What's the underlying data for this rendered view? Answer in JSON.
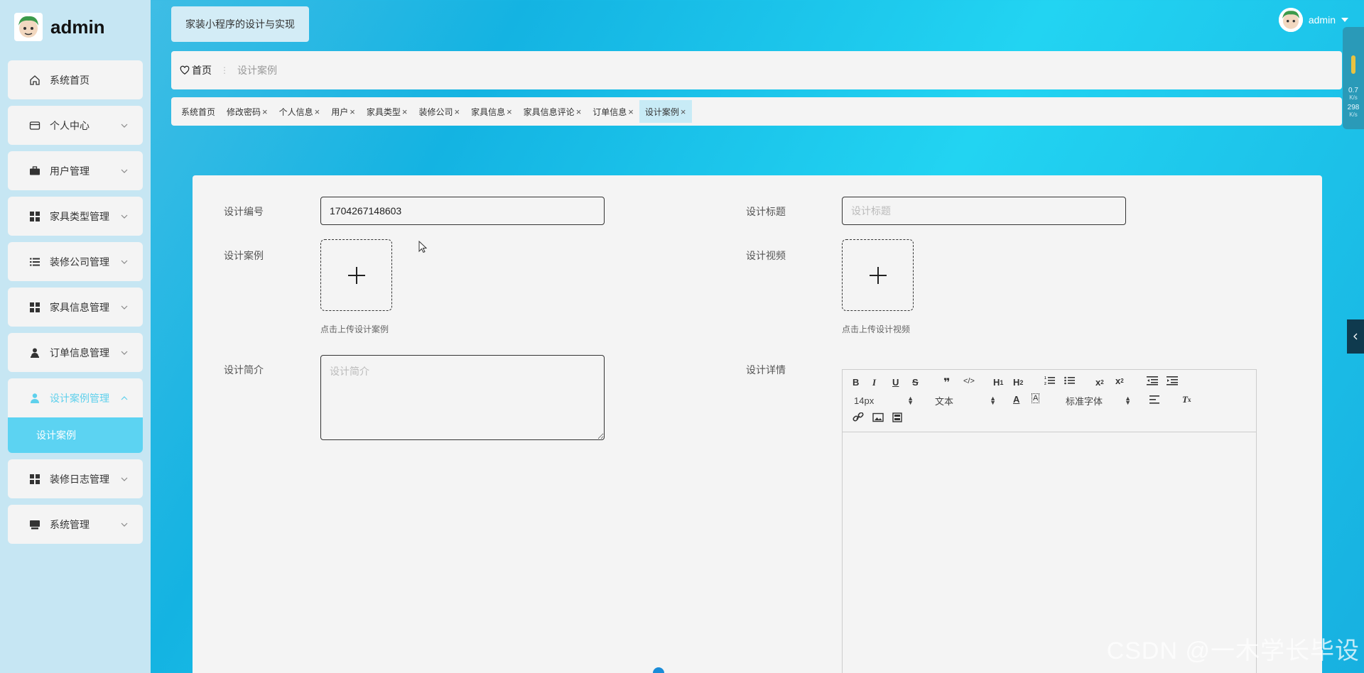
{
  "user": {
    "name": "admin"
  },
  "app_title": "家装小程序的设计与实现",
  "sidebar": {
    "items": [
      {
        "label": "系统首页",
        "icon": "home-icon"
      },
      {
        "label": "个人中心",
        "icon": "card-icon"
      },
      {
        "label": "用户管理",
        "icon": "briefcase-icon"
      },
      {
        "label": "家具类型管理",
        "icon": "grid-icon"
      },
      {
        "label": "装修公司管理",
        "icon": "list-icon"
      },
      {
        "label": "家具信息管理",
        "icon": "grid-icon"
      },
      {
        "label": "订单信息管理",
        "icon": "user-stand-icon"
      },
      {
        "label": "设计案例管理",
        "icon": "person-icon"
      },
      {
        "label": "装修日志管理",
        "icon": "grid-icon"
      },
      {
        "label": "系统管理",
        "icon": "monitor-icon"
      }
    ],
    "active_sub": "设计案例"
  },
  "breadcrumb": {
    "home": "首页",
    "current": "设计案例"
  },
  "tags": [
    {
      "label": "系统首页",
      "closable": false
    },
    {
      "label": "修改密码",
      "closable": true
    },
    {
      "label": "个人信息",
      "closable": true
    },
    {
      "label": "用户",
      "closable": true
    },
    {
      "label": "家具类型",
      "closable": true
    },
    {
      "label": "装修公司",
      "closable": true
    },
    {
      "label": "家具信息",
      "closable": true
    },
    {
      "label": "家具信息评论",
      "closable": true
    },
    {
      "label": "订单信息",
      "closable": true
    },
    {
      "label": "设计案例",
      "closable": true,
      "active": true
    }
  ],
  "form": {
    "code_label": "设计编号",
    "code_value": "1704267148603",
    "title_label": "设计标题",
    "title_placeholder": "设计标题",
    "case_label": "设计案例",
    "case_tip": "点击上传设计案例",
    "video_label": "设计视频",
    "video_tip": "点击上传设计视频",
    "intro_label": "设计简介",
    "intro_placeholder": "设计简介",
    "detail_label": "设计详情"
  },
  "editor": {
    "font_size": "14px",
    "header": "文本",
    "font_family": "标准字体"
  },
  "speed": {
    "up": "0.7",
    "up_unit": "K/s",
    "down": "298",
    "down_unit": "K/s"
  },
  "watermark": "CSDN @一木学长毕设",
  "colors": {
    "accent": "#5cd3f2",
    "background": "#14b3e2",
    "sidebar": "#c6e6f3"
  }
}
